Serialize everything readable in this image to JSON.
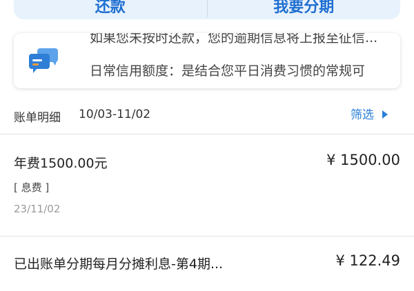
{
  "top_actions": {
    "left_label": "还款",
    "right_label": "我要分期"
  },
  "notice": {
    "icon": "message-icon",
    "line1": "如果您未按时还款，您的逾期信息将上报至征信...",
    "line2": "日常信用额度：是结合您平日消费习惯的常规可"
  },
  "bill_section": {
    "title": "账单明细",
    "date_range": "10/03-11/02",
    "filter_label": "筛选"
  },
  "transactions": [
    {
      "title": "年费1500.00元",
      "amount": "¥ 1500.00",
      "tag": "[ 息费 ]",
      "date": "23/11/02"
    },
    {
      "title": "已出账单分期每月分摊利息-第4期...",
      "amount": "¥ 122.49"
    }
  ],
  "colors": {
    "accent": "#2a7fd8",
    "top_bar_bg": "#e8f2fc",
    "divider": "#e3e3e3"
  }
}
